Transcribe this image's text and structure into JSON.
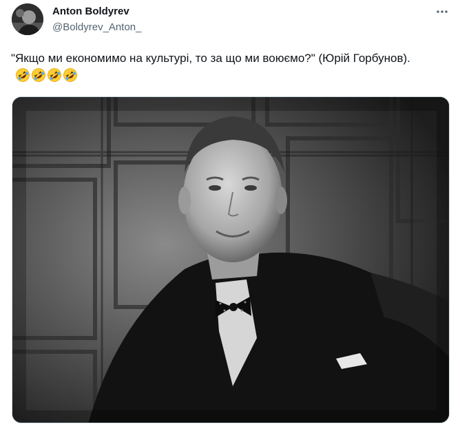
{
  "author": {
    "name": "Anton Boldyrev",
    "handle": "@Boldyrev_Anton_"
  },
  "tweet": {
    "text": "\"Якщо ми економимо на культурі, то за що ми воюємо?\" (Юрій Горбунов).",
    "emoji_icons": [
      "rolling-on-floor-laughing-icon",
      "rolling-on-floor-laughing-icon",
      "rolling-on-floor-laughing-icon",
      "rolling-on-floor-laughing-icon"
    ]
  },
  "colors": {
    "text": "#0f1419",
    "secondary": "#536471",
    "border": "#cfd9de",
    "emoji_yellow": "#ffcc33"
  }
}
